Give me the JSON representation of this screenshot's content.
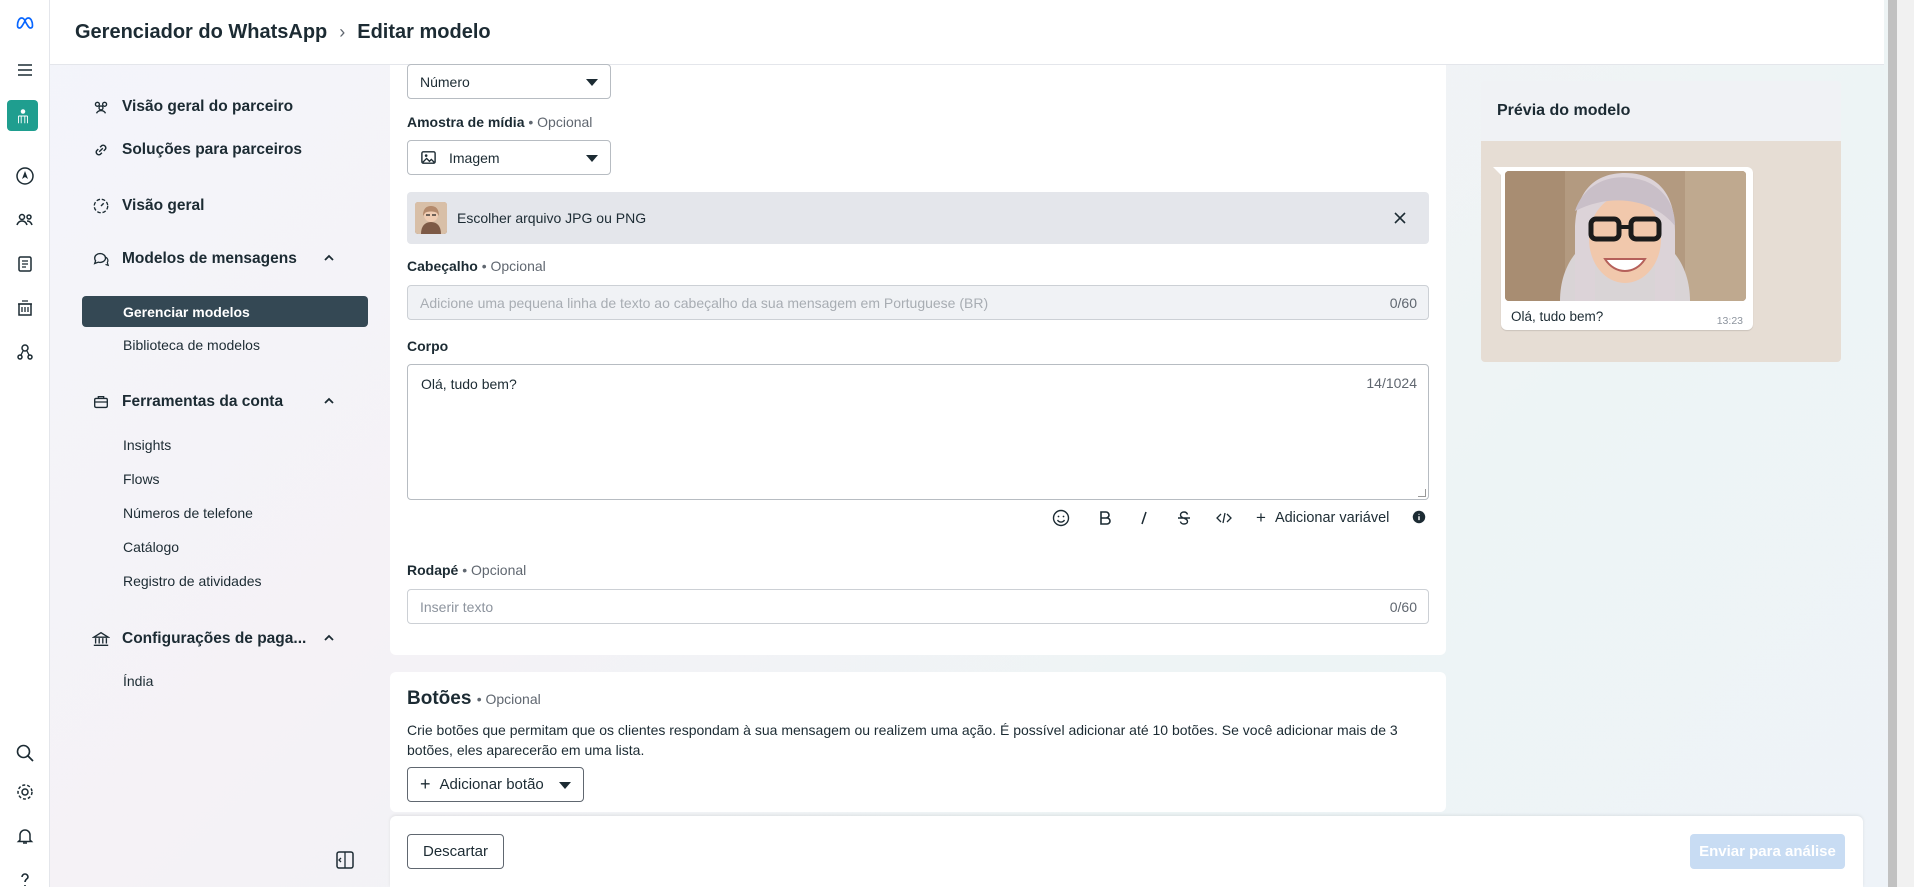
{
  "header": {
    "app_title": "Gerenciador do WhatsApp",
    "page_title": "Editar modelo"
  },
  "sidebar": {
    "items": [
      {
        "label": "Visão geral do parceiro",
        "icon": "partners-icon"
      },
      {
        "label": "Soluções para parceiros",
        "icon": "link-icon"
      },
      {
        "label": "Visão geral",
        "icon": "gauge-icon"
      },
      {
        "label": "Modelos de mensagens",
        "icon": "chat-bubbles-icon"
      },
      {
        "label": "Ferramentas da conta",
        "icon": "briefcase-icon"
      },
      {
        "label": "Configurações de paga...",
        "icon": "bank-icon"
      }
    ],
    "templates_sub": [
      "Gerenciar modelos",
      "Biblioteca de modelos"
    ],
    "tools_sub": [
      "Insights",
      "Flows",
      "Números de telefone",
      "Catálogo",
      "Registro de atividades"
    ],
    "payments_sub": [
      "Índia"
    ]
  },
  "form": {
    "type_select": "Número",
    "media_label": "Amostra de mídia",
    "optional": "• Opcional",
    "media_select": "Imagem",
    "file_text": "Escolher arquivo JPG ou PNG",
    "header_label": "Cabeçalho",
    "header_placeholder": "Adicione uma pequena linha de texto ao cabeçalho da sua mensagem em Portuguese (BR)",
    "header_counter": "0/60",
    "body_label": "Corpo",
    "body_value": "Olá, tudo bem?",
    "body_counter": "14/1024",
    "add_variable": "Adicionar variável",
    "footer_label": "Rodapé",
    "footer_placeholder": "Inserir texto",
    "footer_counter": "0/60"
  },
  "buttons_section": {
    "title": "Botões",
    "optional": "• Opcional",
    "description": "Crie botões que permitam que os clientes respondam à sua mensagem ou realizem uma ação. É possível adicionar até 10 botões. Se você adicionar mais de 3 botões, eles aparecerão em uma lista.",
    "add_button": "Adicionar botão"
  },
  "actions": {
    "discard": "Descartar",
    "submit": "Enviar para análise"
  },
  "preview": {
    "title": "Prévia do modelo",
    "message": "Olá, tudo bem?",
    "time": "13:23"
  },
  "colors": {
    "active_nav": "#344854",
    "submit_disabled": "#c8dcf3",
    "preview_bg": "#e6ddd4"
  }
}
